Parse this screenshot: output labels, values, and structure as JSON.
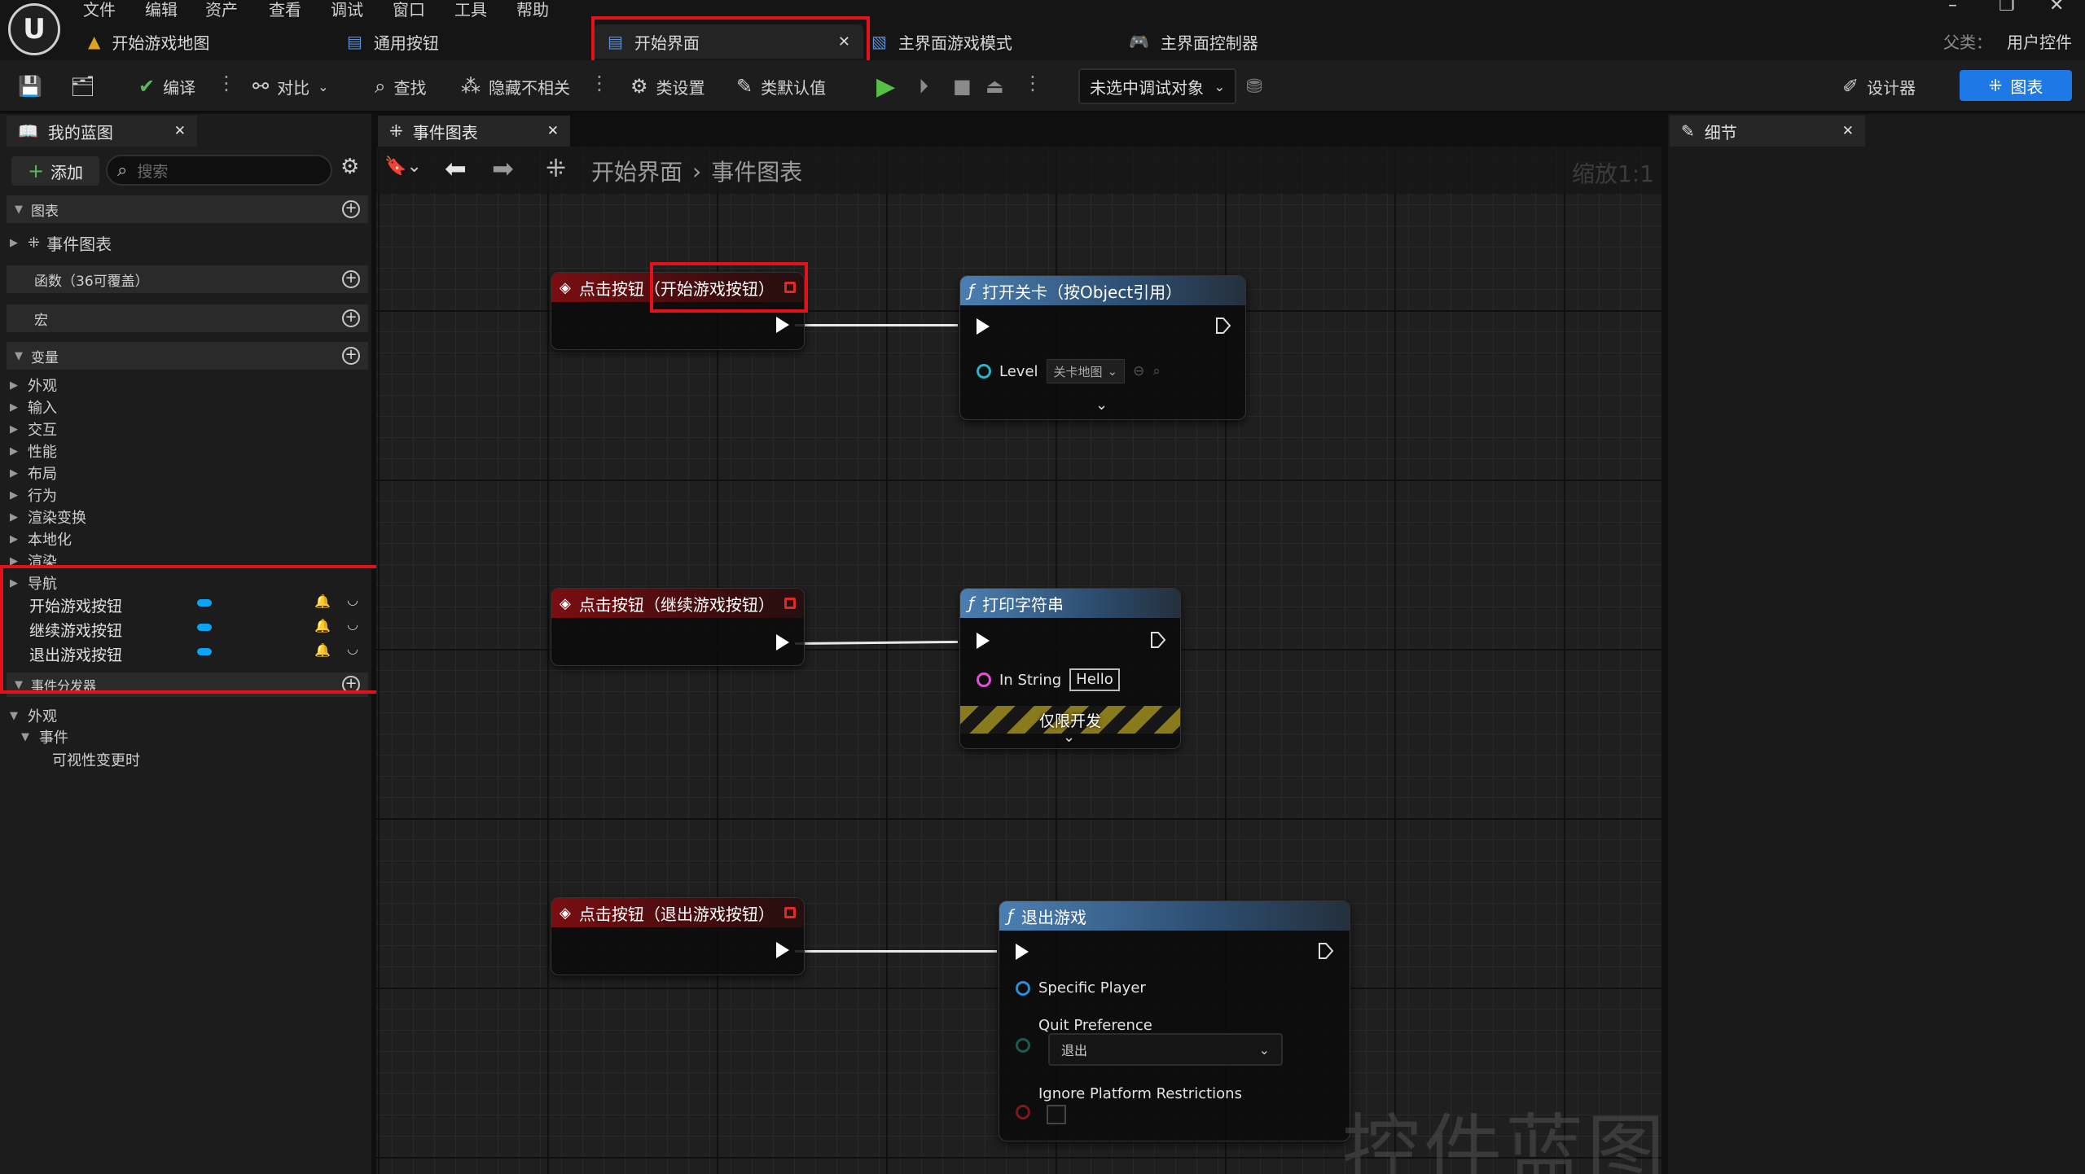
{
  "menu": [
    "文件",
    "编辑",
    "资产",
    "查看",
    "调试",
    "窗口",
    "工具",
    "帮助"
  ],
  "doc_tabs": [
    {
      "label": "开始游戏地图",
      "icon": "level-map-icon"
    },
    {
      "label": "通用按钮",
      "icon": "widget-blueprint-icon"
    },
    {
      "label": "开始界面",
      "icon": "widget-blueprint-icon",
      "active": true
    },
    {
      "label": "主界面游戏模式",
      "icon": "game-mode-icon"
    },
    {
      "label": "主界面控制器",
      "icon": "controller-icon"
    }
  ],
  "parent_class": {
    "label": "父类：",
    "value": "用户控件"
  },
  "toolbar": {
    "compile": "编译",
    "diff": "对比",
    "find": "查找",
    "hide_unrelated": "隐藏不相关",
    "class_settings": "类设置",
    "class_defaults": "类默认值",
    "debug_object": "未选中调试对象",
    "designer": "设计器",
    "graph": "图表"
  },
  "my_blueprint": {
    "tab_label": "我的蓝图",
    "add_label": "添加",
    "search_placeholder": "搜索",
    "graphs_header": "图表",
    "event_graph": "事件图表",
    "functions_header": "函数（36可覆盖）",
    "macros_header": "宏",
    "variables_header": "变量",
    "categories": [
      "外观",
      "输入",
      "交互",
      "性能",
      "布局",
      "行为",
      "渲染变换",
      "本地化",
      "渲染",
      "导航"
    ],
    "variables": [
      "开始游戏按钮",
      "继续游戏按钮",
      "退出游戏按钮"
    ],
    "dispatchers_header": "事件分发器",
    "dispatcher_tree": {
      "appearance": "外观",
      "events": "事件",
      "item": "可视性变更时"
    }
  },
  "graph": {
    "tab_label": "事件图表",
    "breadcrumb": [
      "开始界面",
      "事件图表"
    ],
    "zoom": "缩放1:1",
    "watermark": "控件蓝图"
  },
  "nodes": {
    "evt_start": "点击按钮（开始游戏按钮）",
    "evt_continue": "点击按钮（继续游戏按钮）",
    "evt_quit": "点击按钮（退出游戏按钮）",
    "open_level": {
      "title": "打开关卡（按Object引用）",
      "pin": "Level",
      "value": "关卡地图"
    },
    "print_string": {
      "title": "打印字符串",
      "pin": "In String",
      "value": "Hello",
      "dev_only": "仅限开发"
    },
    "quit_game": {
      "title": "退出游戏",
      "pin_player": "Specific Player",
      "pin_pref": "Quit Preference",
      "pref_value": "退出",
      "pin_ignore": "Ignore Platform Restrictions"
    }
  },
  "details": {
    "tab_label": "细节"
  }
}
